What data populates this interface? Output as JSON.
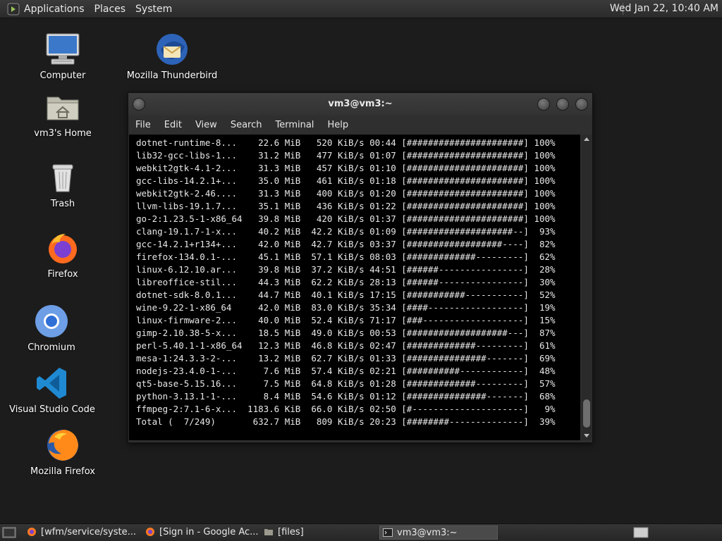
{
  "top_panel": {
    "menu": [
      "Applications",
      "Places",
      "System"
    ],
    "clock": "Wed Jan 22, 10:40 AM"
  },
  "desktop": {
    "icons": [
      {
        "label": "Computer",
        "icon": "computer-icon"
      },
      {
        "label": "Mozilla Thunderbird",
        "icon": "thunderbird-icon"
      },
      {
        "label": "vm3's Home",
        "icon": "home-folder-icon"
      },
      {
        "label": "Trash",
        "icon": "trash-icon"
      },
      {
        "label": "Firefox",
        "icon": "firefox-icon"
      },
      {
        "label": "Chromium",
        "icon": "chromium-icon"
      },
      {
        "label": "Visual Studio Code",
        "icon": "vscode-icon"
      },
      {
        "label": "Mozilla Firefox",
        "icon": "firefox-icon"
      }
    ]
  },
  "terminal": {
    "title": "vm3@vm3:~",
    "menu": [
      "File",
      "Edit",
      "View",
      "Search",
      "Terminal",
      "Help"
    ],
    "lines": [
      "dotnet-runtime-8...    22.6 MiB   520 KiB/s 00:44 [######################] 100%",
      "lib32-gcc-libs-1...    31.2 MiB   477 KiB/s 01:07 [######################] 100%",
      "webkit2gtk-4.1-2...    31.3 MiB   457 KiB/s 01:10 [######################] 100%",
      "gcc-libs-14.2.1+...    35.0 MiB   461 KiB/s 01:18 [######################] 100%",
      "webkit2gtk-2.46....    31.3 MiB   400 KiB/s 01:20 [######################] 100%",
      "llvm-libs-19.1.7...    35.1 MiB   436 KiB/s 01:22 [######################] 100%",
      "go-2:1.23.5-1-x86_64   39.8 MiB   420 KiB/s 01:37 [######################] 100%",
      "clang-19.1.7-1-x...    40.2 MiB  42.2 KiB/s 01:09 [####################--]  93%",
      "gcc-14.2.1+r134+...    42.0 MiB  42.7 KiB/s 03:37 [##################----]  82%",
      "firefox-134.0.1-...    45.1 MiB  57.1 KiB/s 08:03 [#############---------]  62%",
      "linux-6.12.10.ar...    39.8 MiB  37.2 KiB/s 44:51 [######----------------]  28%",
      "libreoffice-stil...    44.3 MiB  62.2 KiB/s 28:13 [######----------------]  30%",
      "dotnet-sdk-8.0.1...    44.7 MiB  40.1 KiB/s 17:15 [###########-----------]  52%",
      "wine-9.22-1-x86_64     42.0 MiB  83.0 KiB/s 35:34 [####------------------]  19%",
      "linux-firmware-2...    40.0 MiB  52.4 KiB/s 71:17 [###-------------------]  15%",
      "gimp-2.10.38-5-x...    18.5 MiB  49.0 KiB/s 00:53 [###################---]  87%",
      "perl-5.40.1-1-x86_64   12.3 MiB  46.8 KiB/s 02:47 [#############---------]  61%",
      "mesa-1:24.3.3-2-...    13.2 MiB  62.7 KiB/s 01:33 [###############-------]  69%",
      "nodejs-23.4.0-1-...     7.6 MiB  57.4 KiB/s 02:21 [##########------------]  48%",
      "qt5-base-5.15.16...     7.5 MiB  64.8 KiB/s 01:28 [#############---------]  57%",
      "python-3.13.1-1-...     8.4 MiB  54.6 KiB/s 01:12 [###############-------]  68%",
      "ffmpeg-2:7.1-6-x...  1183.6 KiB  66.0 KiB/s 02:50 [#---------------------]   9%",
      "Total (  7/249)       632.7 MiB   809 KiB/s 20:23 [########--------------]  39%"
    ]
  },
  "taskbar": {
    "tasks": [
      {
        "label": "[wfm/service/syste...",
        "icon": "firefox-icon"
      },
      {
        "label": "[Sign in - Google Ac...",
        "icon": "firefox-icon"
      },
      {
        "label": "[files]",
        "icon": "folder-icon"
      },
      {
        "label": "vm3@vm3:~",
        "icon": "terminal-icon"
      }
    ]
  }
}
